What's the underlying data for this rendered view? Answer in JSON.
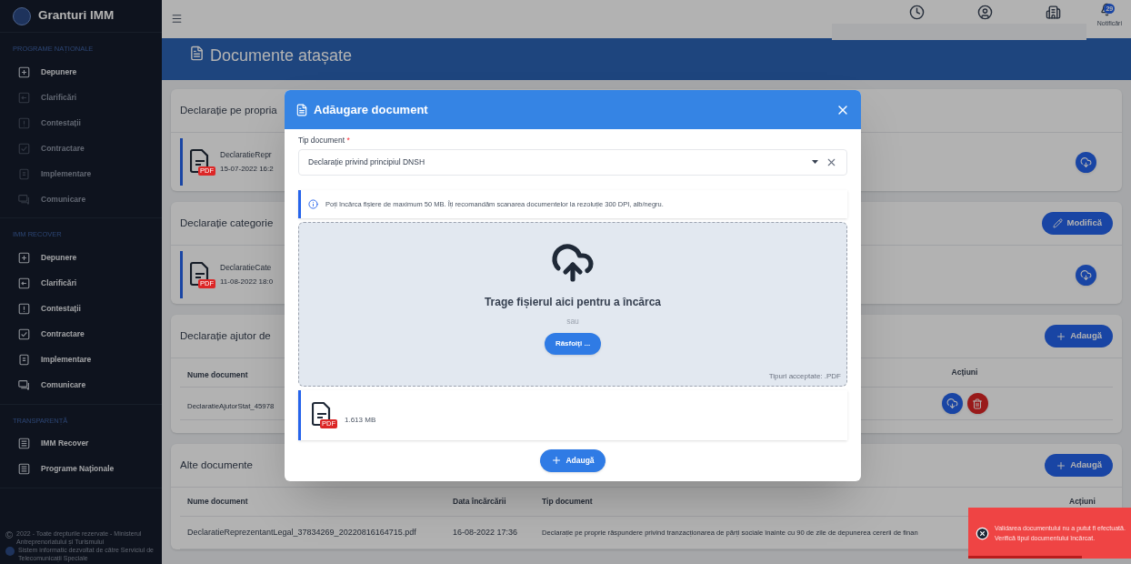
{
  "sidebar": {
    "brand": "Granturi IMM",
    "sections": [
      {
        "title": "PROGRAME NAȚIONALE",
        "items": [
          {
            "label": "Depunere",
            "kind": "submit",
            "disabled": false
          },
          {
            "label": "Clarificări",
            "kind": "clarify",
            "disabled": true
          },
          {
            "label": "Contestații",
            "kind": "appeal",
            "disabled": true
          },
          {
            "label": "Contractare",
            "kind": "contract",
            "disabled": true
          },
          {
            "label": "Implementare",
            "kind": "implement",
            "disabled": true
          },
          {
            "label": "Comunicare",
            "kind": "chat",
            "disabled": true
          }
        ]
      },
      {
        "title": "IMM RECOVER",
        "items": [
          {
            "label": "Depunere",
            "kind": "submit",
            "disabled": false
          },
          {
            "label": "Clarificări",
            "kind": "clarify",
            "disabled": false
          },
          {
            "label": "Contestații",
            "kind": "appeal",
            "disabled": false
          },
          {
            "label": "Contractare",
            "kind": "contract",
            "disabled": false
          },
          {
            "label": "Implementare",
            "kind": "implement",
            "disabled": false
          },
          {
            "label": "Comunicare",
            "kind": "chat",
            "disabled": false
          }
        ]
      },
      {
        "title": "TRANSPARENȚĂ",
        "items": [
          {
            "label": "IMM Recover",
            "kind": "list",
            "disabled": false
          },
          {
            "label": "Programe Naționale",
            "kind": "list",
            "disabled": false
          }
        ]
      }
    ],
    "copyright": "©",
    "footer": [
      "2022 - Toate drepturile rezervate - Ministerul Antreprenoriatului și Turismului",
      "Sistem informatic dezvoltat de către Serviciul de Telecomunicații Speciale"
    ]
  },
  "header": {
    "notifications_count": "29",
    "notifications_label": "Notificări"
  },
  "page_title": "Documente atașate",
  "cards": [
    {
      "kind": "file",
      "title": "Declarație pe propria",
      "file": {
        "name": "DeclaratieRepr",
        "date": "15-07-2022 16:2",
        "badge": "PDF"
      }
    },
    {
      "kind": "file",
      "title": "Declarație categorie",
      "button": "Modifică",
      "file": {
        "name": "DeclaratieCate",
        "date": "11-08-2022 18:0",
        "badge": "PDF"
      }
    },
    {
      "kind": "table_short",
      "title": "Declarație ajutor de",
      "button": "Adaugă",
      "columns": [
        "Nume document",
        "Acțiuni"
      ],
      "rows": [
        [
          "DeclaratieAjutorStat_45978"
        ]
      ]
    },
    {
      "kind": "table_full",
      "title": "Alte documente",
      "button": "Adaugă",
      "columns": [
        "Nume document",
        "Data încărcării",
        "Tip document",
        "Acțiuni"
      ],
      "rows": [
        [
          "DeclaratieReprezentantLegal_37834269_20220816164715.pdf",
          "16-08-2022 17:36",
          "Declarație pe proprie răspundere privind tranzacționarea de părți sociale înainte cu 90 de zile de depunerea cererii de finan"
        ]
      ]
    }
  ],
  "modal": {
    "title": "Adăugare document",
    "field_label": "Tip document",
    "required_mark": "*",
    "field_value": "Declarație privind principiul DNSH",
    "info": "Poți încărca fișiere de maximum 50 MB. Îți recomandăm scanarea documentelor la rezoluție 300 DPI, alb/negru.",
    "drop_text": "Trage fișierul aici pentru a încărca",
    "or": "sau",
    "browse": "Răsfoiți ...",
    "accepted": "Tipuri acceptate: .PDF",
    "file": {
      "badge": "PDF",
      "size": "1.613 MB"
    },
    "submit": "Adaugă"
  },
  "toast": {
    "message": "Validarea documentului nu a putut fi efectuată. Verifică tipul documentului încărcat.",
    "level": 0.7
  }
}
